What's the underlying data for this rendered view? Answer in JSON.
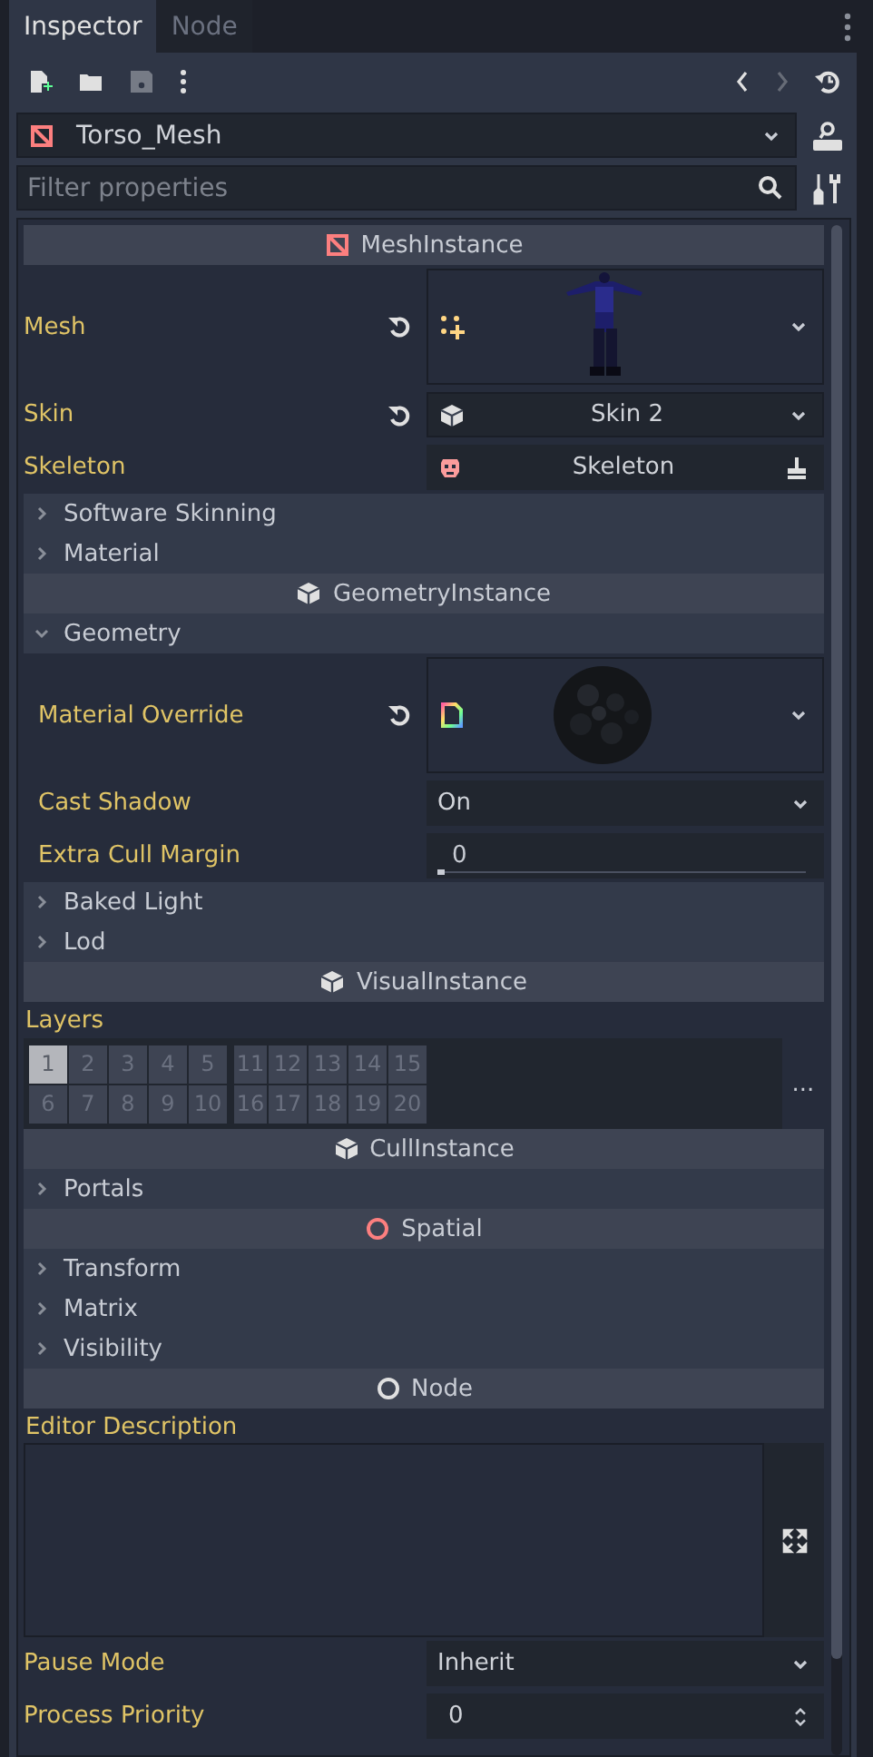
{
  "tabs": [
    {
      "label": "Inspector",
      "selected": true
    },
    {
      "label": "Node",
      "selected": false
    }
  ],
  "node_selector": {
    "name": "Torso_Mesh"
  },
  "filter": {
    "placeholder": "Filter properties"
  },
  "inspector": [
    {
      "kind": "header",
      "label": "MeshInstance"
    },
    {
      "kind": "resource",
      "label": "Mesh",
      "revertable": true
    },
    {
      "kind": "resource_name",
      "label": "Skin",
      "value": "Skin 2",
      "revertable": true
    },
    {
      "kind": "node_path",
      "label": "Skeleton",
      "value": "Skeleton"
    },
    {
      "kind": "section",
      "label": "Software Skinning",
      "expanded": false
    },
    {
      "kind": "section",
      "label": "Material",
      "expanded": false
    },
    {
      "kind": "header",
      "label": "GeometryInstance"
    },
    {
      "kind": "section",
      "label": "Geometry",
      "expanded": true,
      "children": [
        {
          "kind": "resource",
          "label": "Material Override",
          "revertable": true
        },
        {
          "kind": "enum",
          "label": "Cast Shadow",
          "value": "On"
        },
        {
          "kind": "range",
          "label": "Extra Cull Margin",
          "value": "0",
          "level": 0
        }
      ]
    },
    {
      "kind": "section",
      "label": "Baked Light",
      "expanded": false
    },
    {
      "kind": "section",
      "label": "Lod",
      "expanded": false
    },
    {
      "kind": "header",
      "label": "VisualInstance"
    },
    {
      "kind": "layers",
      "label": "Layers",
      "more": "...",
      "cells": [
        {
          "label": "1",
          "selected": true
        },
        {
          "label": "2",
          "selected": false
        },
        {
          "label": "3",
          "selected": false
        },
        {
          "label": "4",
          "selected": false
        },
        {
          "label": "5",
          "selected": false
        },
        {
          "label": "11",
          "selected": false
        },
        {
          "label": "12",
          "selected": false
        },
        {
          "label": "13",
          "selected": false
        },
        {
          "label": "14",
          "selected": false
        },
        {
          "label": "15",
          "selected": false
        },
        {
          "label": "6",
          "selected": false
        },
        {
          "label": "7",
          "selected": false
        },
        {
          "label": "8",
          "selected": false
        },
        {
          "label": "9",
          "selected": false
        },
        {
          "label": "10",
          "selected": false
        },
        {
          "label": "16",
          "selected": false
        },
        {
          "label": "17",
          "selected": false
        },
        {
          "label": "18",
          "selected": false
        },
        {
          "label": "19",
          "selected": false
        },
        {
          "label": "20",
          "selected": false
        }
      ]
    },
    {
      "kind": "header",
      "label": "CullInstance"
    },
    {
      "kind": "section",
      "label": "Portals",
      "expanded": false
    },
    {
      "kind": "header",
      "label": "Spatial"
    },
    {
      "kind": "section",
      "label": "Transform",
      "expanded": false
    },
    {
      "kind": "section",
      "label": "Matrix",
      "expanded": false
    },
    {
      "kind": "section",
      "label": "Visibility",
      "expanded": false
    },
    {
      "kind": "header",
      "label": "Node"
    },
    {
      "kind": "textarea",
      "label": "Editor Description"
    },
    {
      "kind": "enum",
      "label": "Pause Mode",
      "value": "Inherit"
    },
    {
      "kind": "spin",
      "label": "Process Priority",
      "value": "0"
    }
  ]
}
